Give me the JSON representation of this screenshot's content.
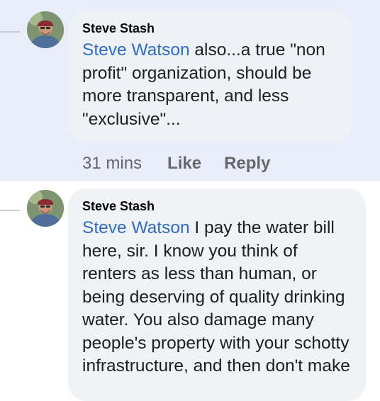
{
  "comments": [
    {
      "author": "Steve Stash",
      "mention": "Steve Watson",
      "text": " also...a true \"non profit\" organization, should be more transparent, and less \"exclusive\"...",
      "time": "31 mins",
      "like_label": "Like",
      "reply_label": "Reply"
    },
    {
      "author": "Steve Stash",
      "mention": "Steve Watson",
      "text": " I pay the water bill here, sir. I know you think of renters as less than human, or being deserving of quality drinking water. You also damage many people's property with your schotty infrastructure, and then don't make"
    }
  ],
  "colors": {
    "highlight_band": "#e7edf9",
    "bubble": "#f0f2f5",
    "mention": "#2d6cc9",
    "meta_text": "#65676b"
  }
}
